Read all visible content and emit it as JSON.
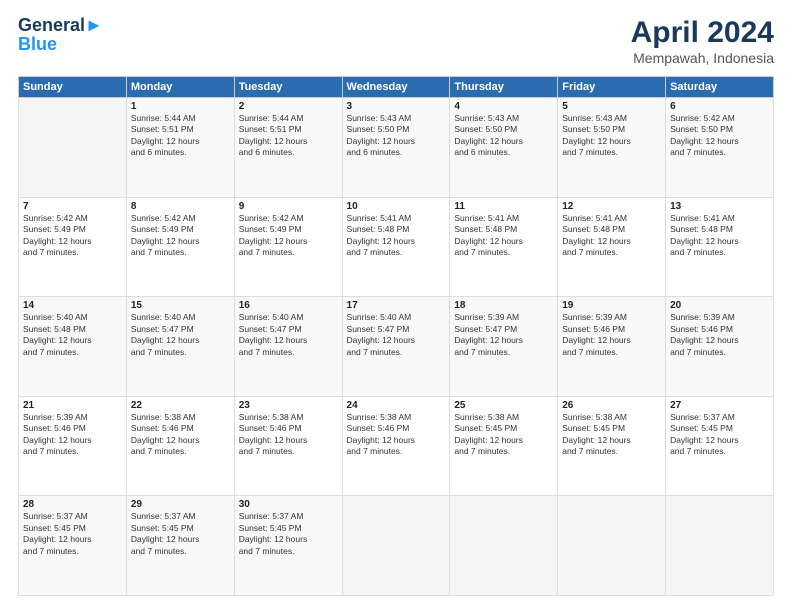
{
  "header": {
    "logo_line1": "General",
    "logo_line2": "Blue",
    "month": "April 2024",
    "location": "Mempawah, Indonesia"
  },
  "days_of_week": [
    "Sunday",
    "Monday",
    "Tuesday",
    "Wednesday",
    "Thursday",
    "Friday",
    "Saturday"
  ],
  "weeks": [
    [
      {
        "day": "",
        "info": ""
      },
      {
        "day": "1",
        "info": "Sunrise: 5:44 AM\nSunset: 5:51 PM\nDaylight: 12 hours\nand 6 minutes."
      },
      {
        "day": "2",
        "info": "Sunrise: 5:44 AM\nSunset: 5:51 PM\nDaylight: 12 hours\nand 6 minutes."
      },
      {
        "day": "3",
        "info": "Sunrise: 5:43 AM\nSunset: 5:50 PM\nDaylight: 12 hours\nand 6 minutes."
      },
      {
        "day": "4",
        "info": "Sunrise: 5:43 AM\nSunset: 5:50 PM\nDaylight: 12 hours\nand 6 minutes."
      },
      {
        "day": "5",
        "info": "Sunrise: 5:43 AM\nSunset: 5:50 PM\nDaylight: 12 hours\nand 7 minutes."
      },
      {
        "day": "6",
        "info": "Sunrise: 5:42 AM\nSunset: 5:50 PM\nDaylight: 12 hours\nand 7 minutes."
      }
    ],
    [
      {
        "day": "7",
        "info": "Sunrise: 5:42 AM\nSunset: 5:49 PM\nDaylight: 12 hours\nand 7 minutes."
      },
      {
        "day": "8",
        "info": "Sunrise: 5:42 AM\nSunset: 5:49 PM\nDaylight: 12 hours\nand 7 minutes."
      },
      {
        "day": "9",
        "info": "Sunrise: 5:42 AM\nSunset: 5:49 PM\nDaylight: 12 hours\nand 7 minutes."
      },
      {
        "day": "10",
        "info": "Sunrise: 5:41 AM\nSunset: 5:48 PM\nDaylight: 12 hours\nand 7 minutes."
      },
      {
        "day": "11",
        "info": "Sunrise: 5:41 AM\nSunset: 5:48 PM\nDaylight: 12 hours\nand 7 minutes."
      },
      {
        "day": "12",
        "info": "Sunrise: 5:41 AM\nSunset: 5:48 PM\nDaylight: 12 hours\nand 7 minutes."
      },
      {
        "day": "13",
        "info": "Sunrise: 5:41 AM\nSunset: 5:48 PM\nDaylight: 12 hours\nand 7 minutes."
      }
    ],
    [
      {
        "day": "14",
        "info": "Sunrise: 5:40 AM\nSunset: 5:48 PM\nDaylight: 12 hours\nand 7 minutes."
      },
      {
        "day": "15",
        "info": "Sunrise: 5:40 AM\nSunset: 5:47 PM\nDaylight: 12 hours\nand 7 minutes."
      },
      {
        "day": "16",
        "info": "Sunrise: 5:40 AM\nSunset: 5:47 PM\nDaylight: 12 hours\nand 7 minutes."
      },
      {
        "day": "17",
        "info": "Sunrise: 5:40 AM\nSunset: 5:47 PM\nDaylight: 12 hours\nand 7 minutes."
      },
      {
        "day": "18",
        "info": "Sunrise: 5:39 AM\nSunset: 5:47 PM\nDaylight: 12 hours\nand 7 minutes."
      },
      {
        "day": "19",
        "info": "Sunrise: 5:39 AM\nSunset: 5:46 PM\nDaylight: 12 hours\nand 7 minutes."
      },
      {
        "day": "20",
        "info": "Sunrise: 5:39 AM\nSunset: 5:46 PM\nDaylight: 12 hours\nand 7 minutes."
      }
    ],
    [
      {
        "day": "21",
        "info": "Sunrise: 5:39 AM\nSunset: 5:46 PM\nDaylight: 12 hours\nand 7 minutes."
      },
      {
        "day": "22",
        "info": "Sunrise: 5:38 AM\nSunset: 5:46 PM\nDaylight: 12 hours\nand 7 minutes."
      },
      {
        "day": "23",
        "info": "Sunrise: 5:38 AM\nSunset: 5:46 PM\nDaylight: 12 hours\nand 7 minutes."
      },
      {
        "day": "24",
        "info": "Sunrise: 5:38 AM\nSunset: 5:46 PM\nDaylight: 12 hours\nand 7 minutes."
      },
      {
        "day": "25",
        "info": "Sunrise: 5:38 AM\nSunset: 5:45 PM\nDaylight: 12 hours\nand 7 minutes."
      },
      {
        "day": "26",
        "info": "Sunrise: 5:38 AM\nSunset: 5:45 PM\nDaylight: 12 hours\nand 7 minutes."
      },
      {
        "day": "27",
        "info": "Sunrise: 5:37 AM\nSunset: 5:45 PM\nDaylight: 12 hours\nand 7 minutes."
      }
    ],
    [
      {
        "day": "28",
        "info": "Sunrise: 5:37 AM\nSunset: 5:45 PM\nDaylight: 12 hours\nand 7 minutes."
      },
      {
        "day": "29",
        "info": "Sunrise: 5:37 AM\nSunset: 5:45 PM\nDaylight: 12 hours\nand 7 minutes."
      },
      {
        "day": "30",
        "info": "Sunrise: 5:37 AM\nSunset: 5:45 PM\nDaylight: 12 hours\nand 7 minutes."
      },
      {
        "day": "",
        "info": ""
      },
      {
        "day": "",
        "info": ""
      },
      {
        "day": "",
        "info": ""
      },
      {
        "day": "",
        "info": ""
      }
    ]
  ]
}
